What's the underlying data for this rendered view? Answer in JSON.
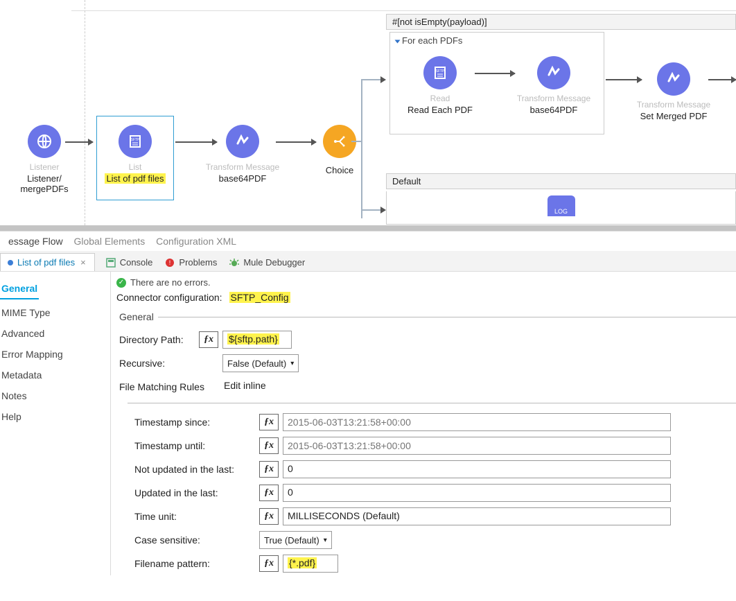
{
  "flow": {
    "listener": {
      "type": "Listener",
      "name": "Listener/\nmergePDFs"
    },
    "list": {
      "type": "List",
      "name": "List of pdf files"
    },
    "tm1": {
      "type": "Transform Message",
      "name": "base64PDF"
    },
    "choice": {
      "name": "Choice"
    },
    "condition": "#[not isEmpty(payload)]",
    "foreach": {
      "title": "For each PDFs",
      "read": {
        "type": "Read",
        "name": "Read Each PDF"
      },
      "tm": {
        "type": "Transform Message",
        "name": "base64PDF"
      }
    },
    "tm2": {
      "type": "Transform Message",
      "name": "Set Merged PDF"
    },
    "default": "Default",
    "log": "LOG"
  },
  "subtabs": {
    "a": "essage Flow",
    "b": "Global Elements",
    "c": "Configuration XML"
  },
  "tab": {
    "title": "List of pdf files",
    "close": "×"
  },
  "toolbar": {
    "console": "Console",
    "problems": "Problems",
    "debugger": "Mule Debugger"
  },
  "nav": [
    "General",
    "MIME Type",
    "Advanced",
    "Error Mapping",
    "Metadata",
    "Notes",
    "Help"
  ],
  "status": "There are no errors.",
  "cfg": {
    "label": "Connector configuration:",
    "value": "SFTP_Config"
  },
  "general": {
    "legend": "General",
    "dirpath": {
      "label": "Directory Path:",
      "value": "${sftp.path}"
    },
    "recursive": {
      "label": "Recursive:",
      "value": "False (Default)"
    },
    "fmr": {
      "label": "File Matching Rules",
      "value": "Edit inline"
    }
  },
  "rules": {
    "ts_since": {
      "label": "Timestamp since:",
      "value": "",
      "ph": "2015-06-03T13:21:58+00:00"
    },
    "ts_until": {
      "label": "Timestamp until:",
      "value": "",
      "ph": "2015-06-03T13:21:58+00:00"
    },
    "not_upd": {
      "label": "Not updated in the last:",
      "value": "0"
    },
    "upd": {
      "label": "Updated in the last:",
      "value": "0"
    },
    "unit": {
      "label": "Time unit:",
      "value": "MILLISECONDS (Default)"
    },
    "case": {
      "label": "Case sensitive:",
      "value": "True (Default)"
    },
    "pattern": {
      "label": "Filename pattern:",
      "value": "{*.pdf}"
    }
  },
  "fx": "ƒx"
}
